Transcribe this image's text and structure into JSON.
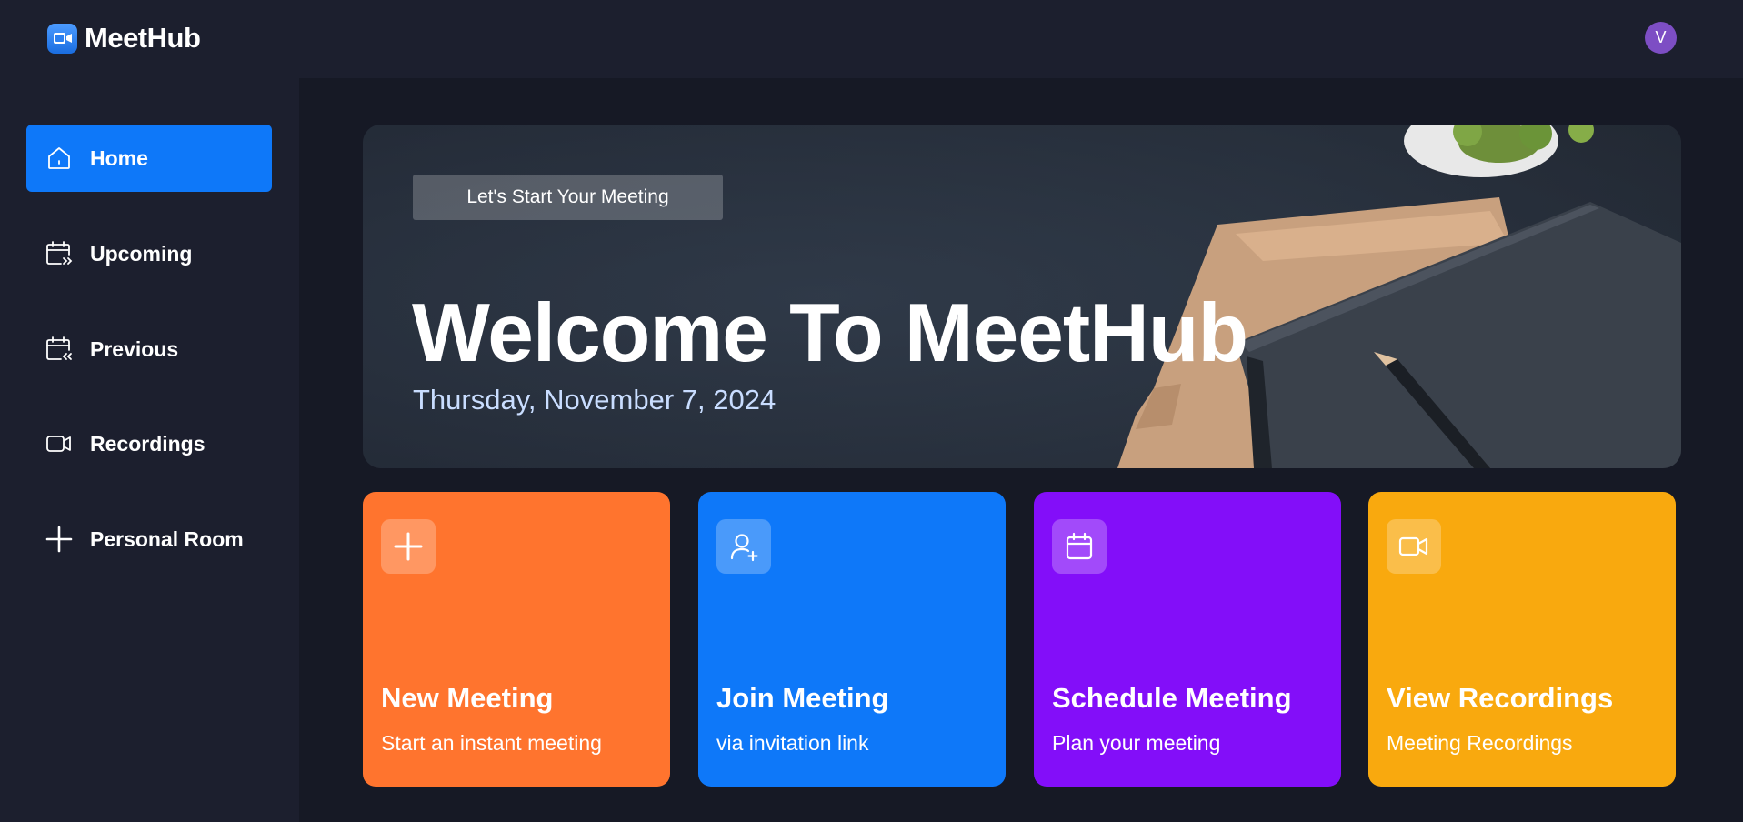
{
  "app": {
    "name": "MeetHub",
    "user_initial": "V",
    "avatar_color": "#7d4ec4"
  },
  "sidebar": {
    "items": [
      {
        "label": "Home",
        "icon": "home-icon",
        "active": true
      },
      {
        "label": "Upcoming",
        "icon": "calendar-upcoming-icon",
        "active": false
      },
      {
        "label": "Previous",
        "icon": "calendar-previous-icon",
        "active": false
      },
      {
        "label": "Recordings",
        "icon": "video-icon",
        "active": false
      },
      {
        "label": "Personal Room",
        "icon": "plus-icon",
        "active": false
      }
    ]
  },
  "hero": {
    "badge": "Let's Start Your Meeting",
    "title": "Welcome To MeetHub",
    "date": "Thursday, November 7, 2024"
  },
  "cards": [
    {
      "title": "New Meeting",
      "subtitle": "Start an instant meeting",
      "icon": "plus-icon",
      "color": "#ff742e"
    },
    {
      "title": "Join Meeting",
      "subtitle": "via invitation link",
      "icon": "user-add-icon",
      "color": "#0e78f9"
    },
    {
      "title": "Schedule Meeting",
      "subtitle": "Plan your meeting",
      "icon": "calendar-icon",
      "color": "#830ef9"
    },
    {
      "title": "View Recordings",
      "subtitle": "Meeting Recordings",
      "icon": "video-icon",
      "color": "#f9a90e"
    }
  ],
  "colors": {
    "background": "#161925",
    "panel": "#1c1f2e",
    "accent": "#0e78f9"
  }
}
